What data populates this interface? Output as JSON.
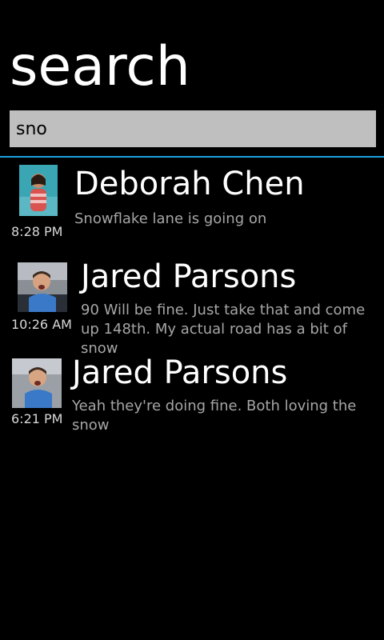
{
  "header": {
    "title": "search"
  },
  "search": {
    "value": "sno"
  },
  "accent_color": "#1ba1e2",
  "results": [
    {
      "name": "Deborah Chen",
      "snippet": "Snowflake lane is going on",
      "time": "8:28 PM",
      "avatar_icon": "contact-photo-icon"
    },
    {
      "name": "Jared Parsons",
      "snippet": "90 Will be fine. Just take that and come up 148th. My actual road has a bit of snow",
      "time": "10:26 AM",
      "avatar_icon": "contact-photo-icon"
    },
    {
      "name": "Jared Parsons",
      "snippet": "Yeah they're doing fine. Both loving the snow",
      "time": "6:21 PM",
      "avatar_icon": "contact-photo-icon"
    }
  ]
}
